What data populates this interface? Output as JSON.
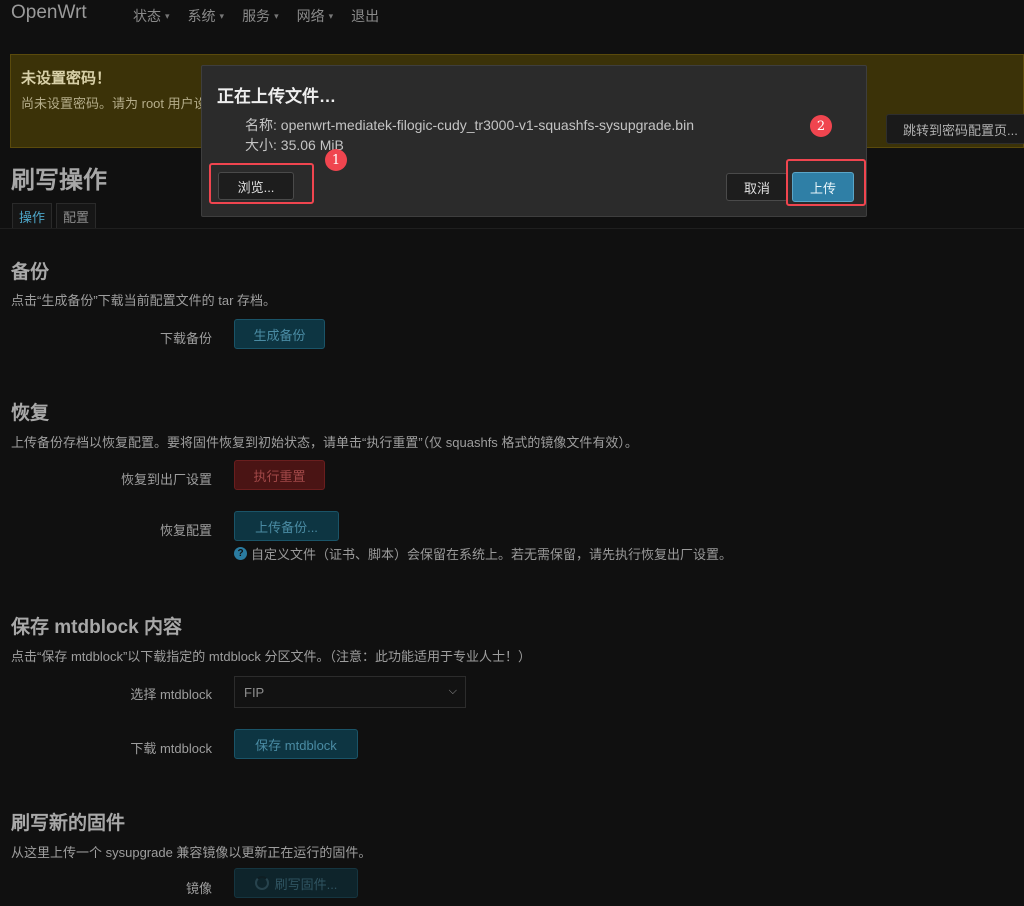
{
  "header": {
    "brand": "OpenWrt",
    "nav": [
      {
        "label": "状态",
        "has_dropdown": true
      },
      {
        "label": "系统",
        "has_dropdown": true
      },
      {
        "label": "服务",
        "has_dropdown": true
      },
      {
        "label": "网络",
        "has_dropdown": true
      },
      {
        "label": "退出",
        "has_dropdown": false
      }
    ]
  },
  "banner": {
    "title": "未设置密码！",
    "text": "尚未设置密码。请为 root 用户设",
    "button": "跳转到密码配置页..."
  },
  "page": {
    "title": "刷写操作",
    "tabs": [
      "操作",
      "配置"
    ],
    "active_tab": "操作"
  },
  "backup": {
    "title": "备份",
    "desc": "点击“生成备份”下载当前配置文件的 tar 存档。",
    "label": "下载备份",
    "button": "生成备份"
  },
  "restore": {
    "title": "恢复",
    "desc": "上传备份存档以恢复配置。要将固件恢复到初始状态，请单击“执行重置”（仅 squashfs 格式的镜像文件有效）。",
    "reset_label": "恢复到出厂设置",
    "reset_button": "执行重置",
    "restore_label": "恢复配置",
    "upload_button": "上传备份...",
    "hint": "自定义文件（证书、脚本）会保留在系统上。若无需保留，请先执行恢复出厂设置。"
  },
  "mtd": {
    "title": "保存 mtdblock 内容",
    "desc": "点击“保存 mtdblock”以下载指定的 mtdblock 分区文件。（注意：此功能适用于专业人士！）",
    "select_label": "选择 mtdblock",
    "select_value": "FIP",
    "download_label": "下载 mtdblock",
    "download_button": "保存 mtdblock"
  },
  "flash": {
    "title": "刷写新的固件",
    "desc": "从这里上传一个 sysupgrade 兼容镜像以更新正在运行的固件。",
    "image_label": "镜像",
    "image_button": "刷写固件..."
  },
  "modal": {
    "title": "正在上传文件…",
    "name_line": "名称: openwrt-mediatek-filogic-cudy_tr3000-v1-squashfs-sysupgrade.bin",
    "size_line": "大小: 35.06 MiB",
    "browse": "浏览...",
    "cancel": "取消",
    "upload": "上传"
  },
  "annotations": {
    "marker1": "1",
    "marker2": "2",
    "color": "#f0454f"
  },
  "colors": {
    "accent": "#2f7fa6",
    "danger": "#4a1414",
    "warning_bg": "#3b3208"
  }
}
